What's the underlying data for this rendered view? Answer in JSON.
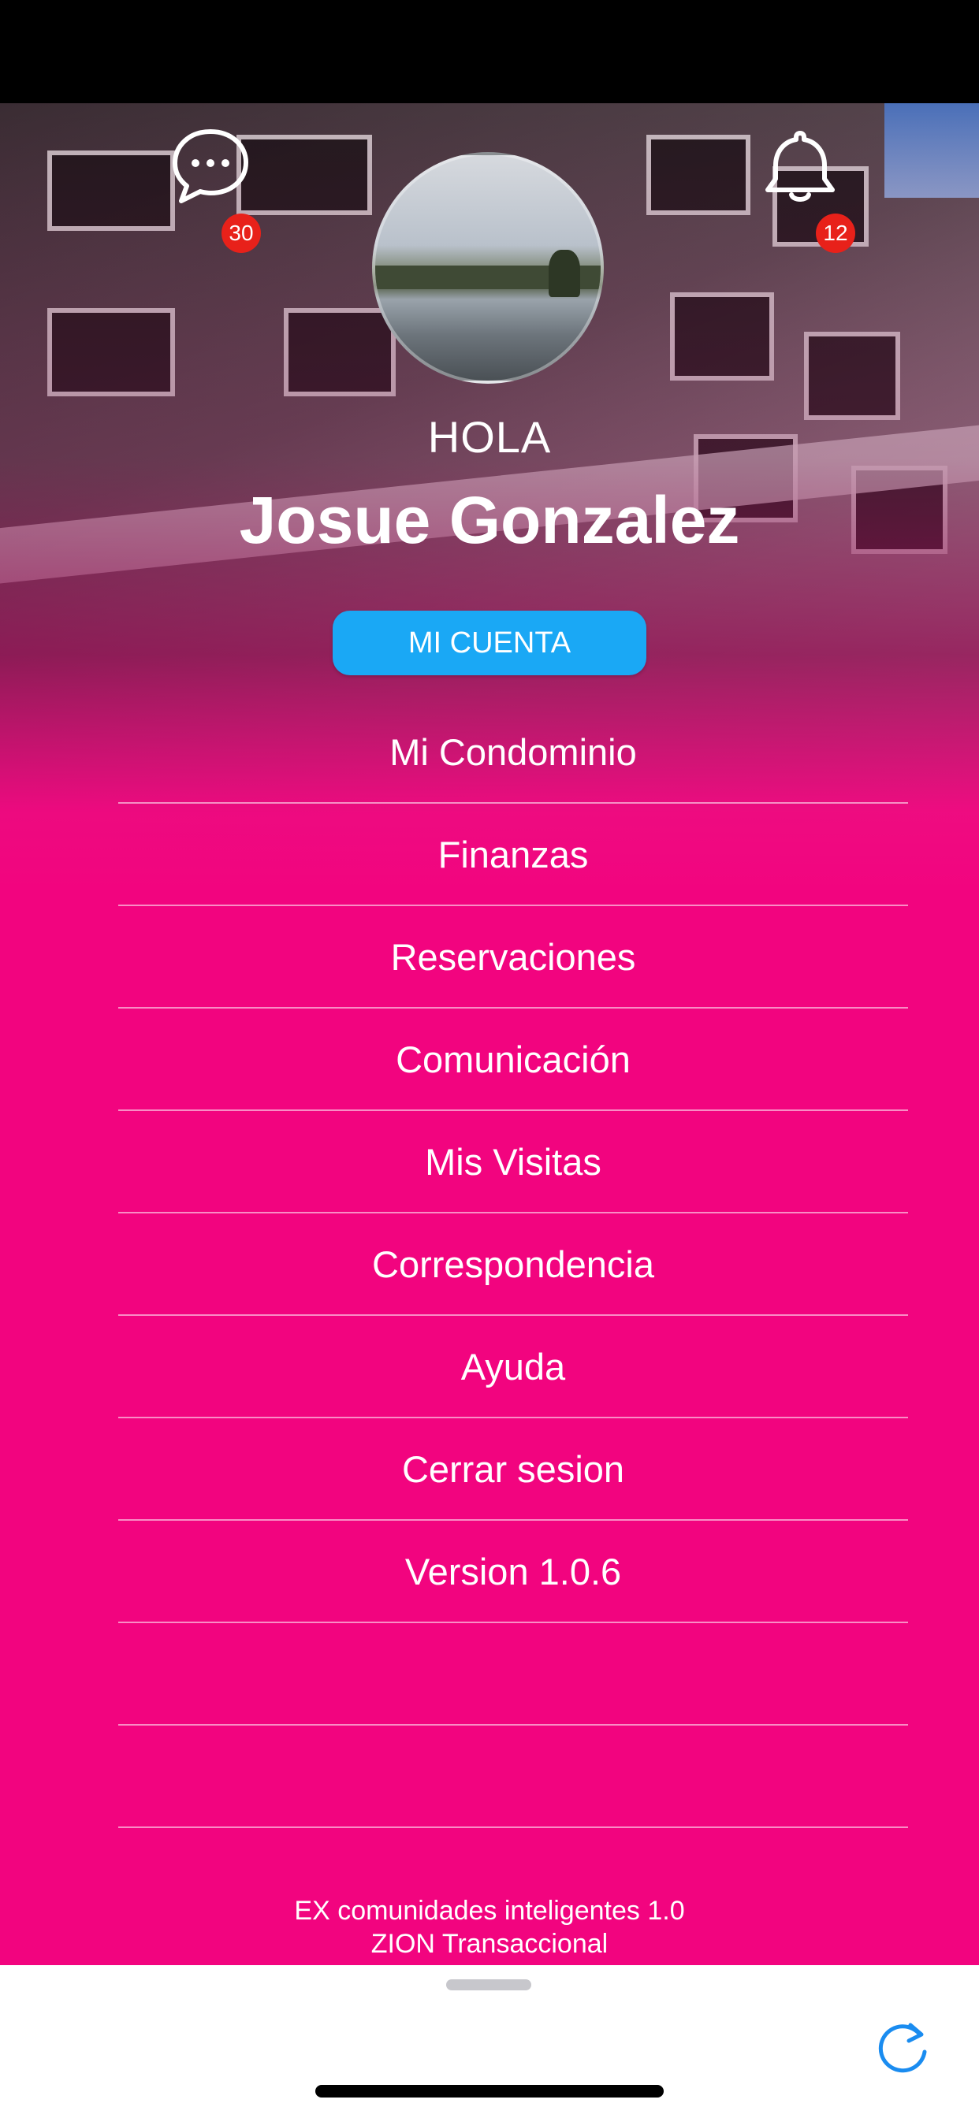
{
  "header": {
    "messages_badge": "30",
    "notifications_badge": "12"
  },
  "profile": {
    "greeting": "HOLA",
    "name": "Josue Gonzalez",
    "account_button": "MI CUENTA"
  },
  "menu": {
    "items": [
      {
        "label": "Mi Condominio"
      },
      {
        "label": "Finanzas"
      },
      {
        "label": "Reservaciones"
      },
      {
        "label": "Comunicación"
      },
      {
        "label": "Mis Visitas"
      },
      {
        "label": "Correspondencia"
      },
      {
        "label": "Ayuda"
      },
      {
        "label": "Cerrar sesion"
      },
      {
        "label": "Version 1.0.6"
      },
      {
        "label": ""
      },
      {
        "label": ""
      }
    ]
  },
  "footer": {
    "line1": "EX comunidades inteligentes 1.0",
    "line2": "ZION Transaccional"
  },
  "icons": {
    "messages": "chat-bubble-icon",
    "notifications": "bell-icon",
    "refresh": "refresh-icon"
  },
  "colors": {
    "background_pink": "#f2047f",
    "account_button": "#1aa8f5",
    "badge": "#e8211a",
    "refresh_icon": "#1a8cf0"
  }
}
